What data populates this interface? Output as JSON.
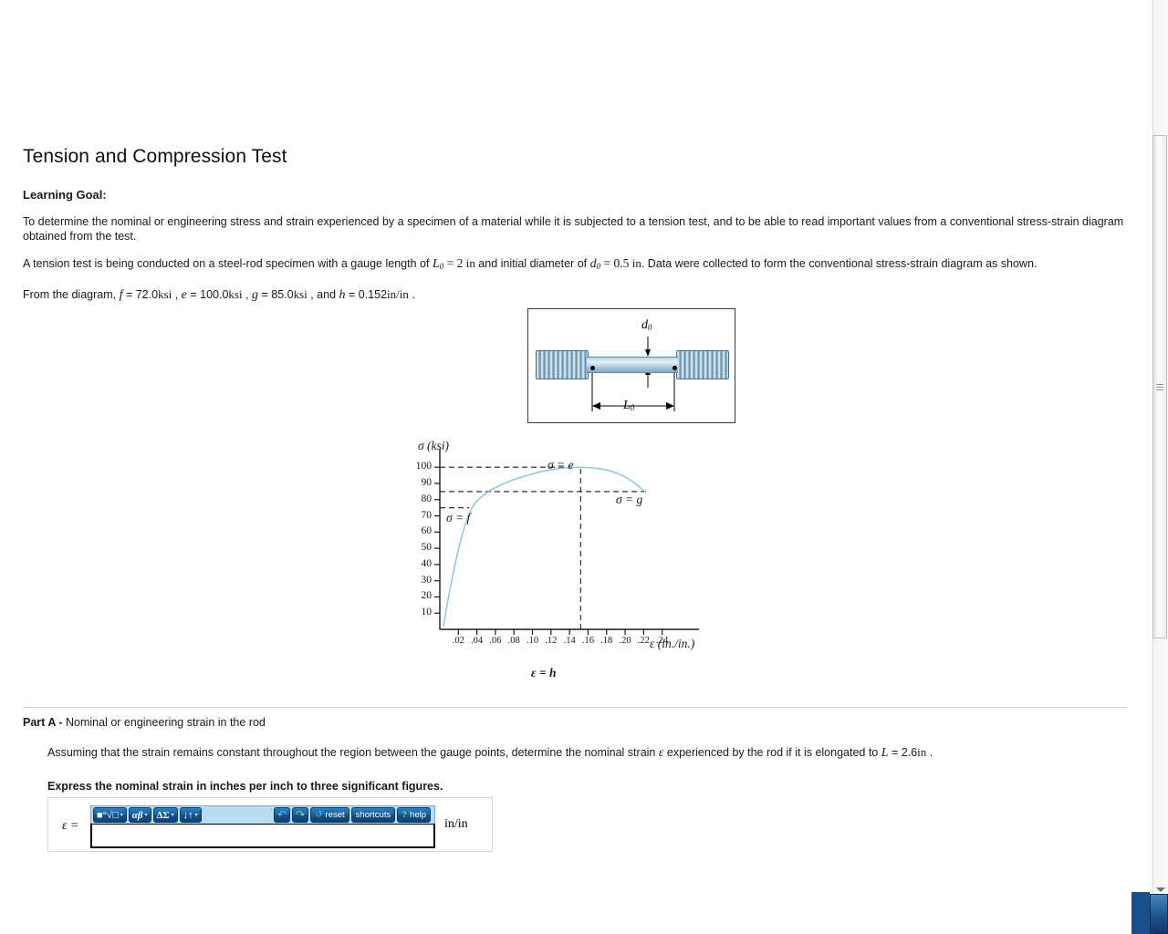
{
  "document": {
    "title": "Tension and Compression Test",
    "learning_goal_label": "Learning Goal:",
    "paragraph1": "To determine the nominal or engineering stress and strain experienced by a specimen of a material while it is subjected to a tension test, and to be able to read important values from a conventional stress-strain diagram obtained from the test.",
    "p2_pre": "A tension test is being conducted on a steel-rod specimen with a gauge length of ",
    "p2_L0_sym": "L",
    "p2_L0_sub": "0",
    "p2_L0_eq": " = 2 ",
    "p2_L0_unit": "in",
    "p2_mid": " and initial diameter of ",
    "p2_d0_sym": "d",
    "p2_d0_sub": "0",
    "p2_d0_eq": " = 0.5 ",
    "p2_d0_unit": "in",
    "p2_post": ". Data were collected to form the conventional stress-strain diagram as shown.",
    "p3_pre": "From the diagram, ",
    "p3_f_sym": "f",
    "p3_f_val": " = 72.0",
    "p3_f_unit": "ksi",
    "p3_sep1": " , ",
    "p3_e_sym": "e",
    "p3_e_val": " = 100.0",
    "p3_e_unit": "ksi",
    "p3_sep2": " , ",
    "p3_g_sym": "g",
    "p3_g_val": " = 85.0",
    "p3_g_unit": "ksi",
    "p3_sep3": " , and ",
    "p3_h_sym": "h",
    "p3_h_val": " = 0.152",
    "p3_h_unit": "in/in",
    "p3_end": " ."
  },
  "specimen_figure": {
    "diameter_label": "d",
    "diameter_sub": "0",
    "gauge_label": "L",
    "gauge_sub": "0"
  },
  "chart_data": {
    "type": "line",
    "title": "",
    "ylabel": "σ (ksi)",
    "xlabel": "ε (in./in.)",
    "x_axis_caption": "ε = h",
    "ylim": [
      0,
      108
    ],
    "xlim": [
      0,
      0.262
    ],
    "yticks": [
      10,
      20,
      30,
      40,
      50,
      60,
      70,
      80,
      90,
      100
    ],
    "ytick_labels": [
      "10",
      "20",
      "30",
      "40",
      "50",
      "60",
      "70",
      "80",
      "90",
      "100"
    ],
    "xticks": [
      0.02,
      0.04,
      0.06,
      0.08,
      0.1,
      0.12,
      0.14,
      0.16,
      0.18,
      0.2,
      0.22,
      0.24
    ],
    "xtick_labels": [
      ".02",
      ".04",
      ".06",
      ".08",
      ".10",
      ".12",
      ".14",
      ".16",
      ".18",
      ".20",
      ".22",
      ".24"
    ],
    "grid": false,
    "legend": "none",
    "series": [
      {
        "name": "stress-strain curve",
        "color": "#8ec6e0",
        "x": [
          0.004,
          0.01,
          0.018,
          0.026,
          0.034,
          0.04,
          0.05,
          0.062,
          0.078,
          0.095,
          0.112,
          0.13,
          0.15,
          0.168,
          0.185,
          0.2,
          0.212,
          0.221
        ],
        "y": [
          2,
          22,
          44,
          62,
          74,
          79,
          84,
          88,
          92,
          95,
          97.5,
          99.3,
          100,
          99.4,
          97.5,
          94,
          89.5,
          85
        ]
      }
    ],
    "annotations": [
      {
        "name": "sigma-e",
        "label": "σ = e",
        "x": 0.152,
        "y": 100,
        "kind": "peak"
      },
      {
        "name": "sigma-g",
        "label": "σ = g",
        "x": 0.226,
        "y": 85,
        "kind": "end"
      },
      {
        "name": "sigma-f",
        "label": "σ = f",
        "x": 0.04,
        "y": 75,
        "kind": "yield"
      }
    ],
    "dashed_guides": [
      {
        "name": "guide-100",
        "y": 100,
        "from_x": 0.0,
        "to_x": 0.152
      },
      {
        "name": "guide-85",
        "y": 85,
        "from_x": 0.0,
        "to_x": 0.226
      },
      {
        "name": "guide-75",
        "y": 75,
        "from_x": 0.0,
        "to_x": 0.032
      },
      {
        "name": "guide-vertical-h",
        "x": 0.152,
        "from_y": 0,
        "to_y": 100
      }
    ]
  },
  "part_a": {
    "label": "Part A -",
    "heading": " Nominal or engineering strain in the rod",
    "body_pre": "Assuming that the strain remains constant throughout the region between the gauge points, determine the nominal strain ",
    "body_eps": "ε",
    "body_mid": " experienced by the rod if it is elongated to ",
    "body_L": "L",
    "body_L_eq": " = 2.6",
    "body_L_unit": "in",
    "body_end": " .",
    "express": "Express the nominal strain in inches per inch to three significant figures."
  },
  "answer": {
    "variable": "ε =",
    "unit": "in/in",
    "input_value": "",
    "input_placeholder": "",
    "toolbar": {
      "template_label": "■°√□",
      "greek_label": "αβ",
      "symbols_label": "ΔΣ",
      "arrows_label": "↓↑",
      "undo_label": "↶",
      "redo_label": "↷",
      "reset_label": "reset",
      "reset_icon": "↺",
      "shortcuts_label": "shortcuts",
      "help_label": "help",
      "help_icon": "?",
      "caret": "▾"
    }
  },
  "colors": {
    "curve": "#8ec6e0",
    "toolbar_bg": "#b8dcf0",
    "button_blue": "#1a5f9e",
    "accent_green": "#6ee36e",
    "accent_cyan": "#4fc3f7"
  }
}
